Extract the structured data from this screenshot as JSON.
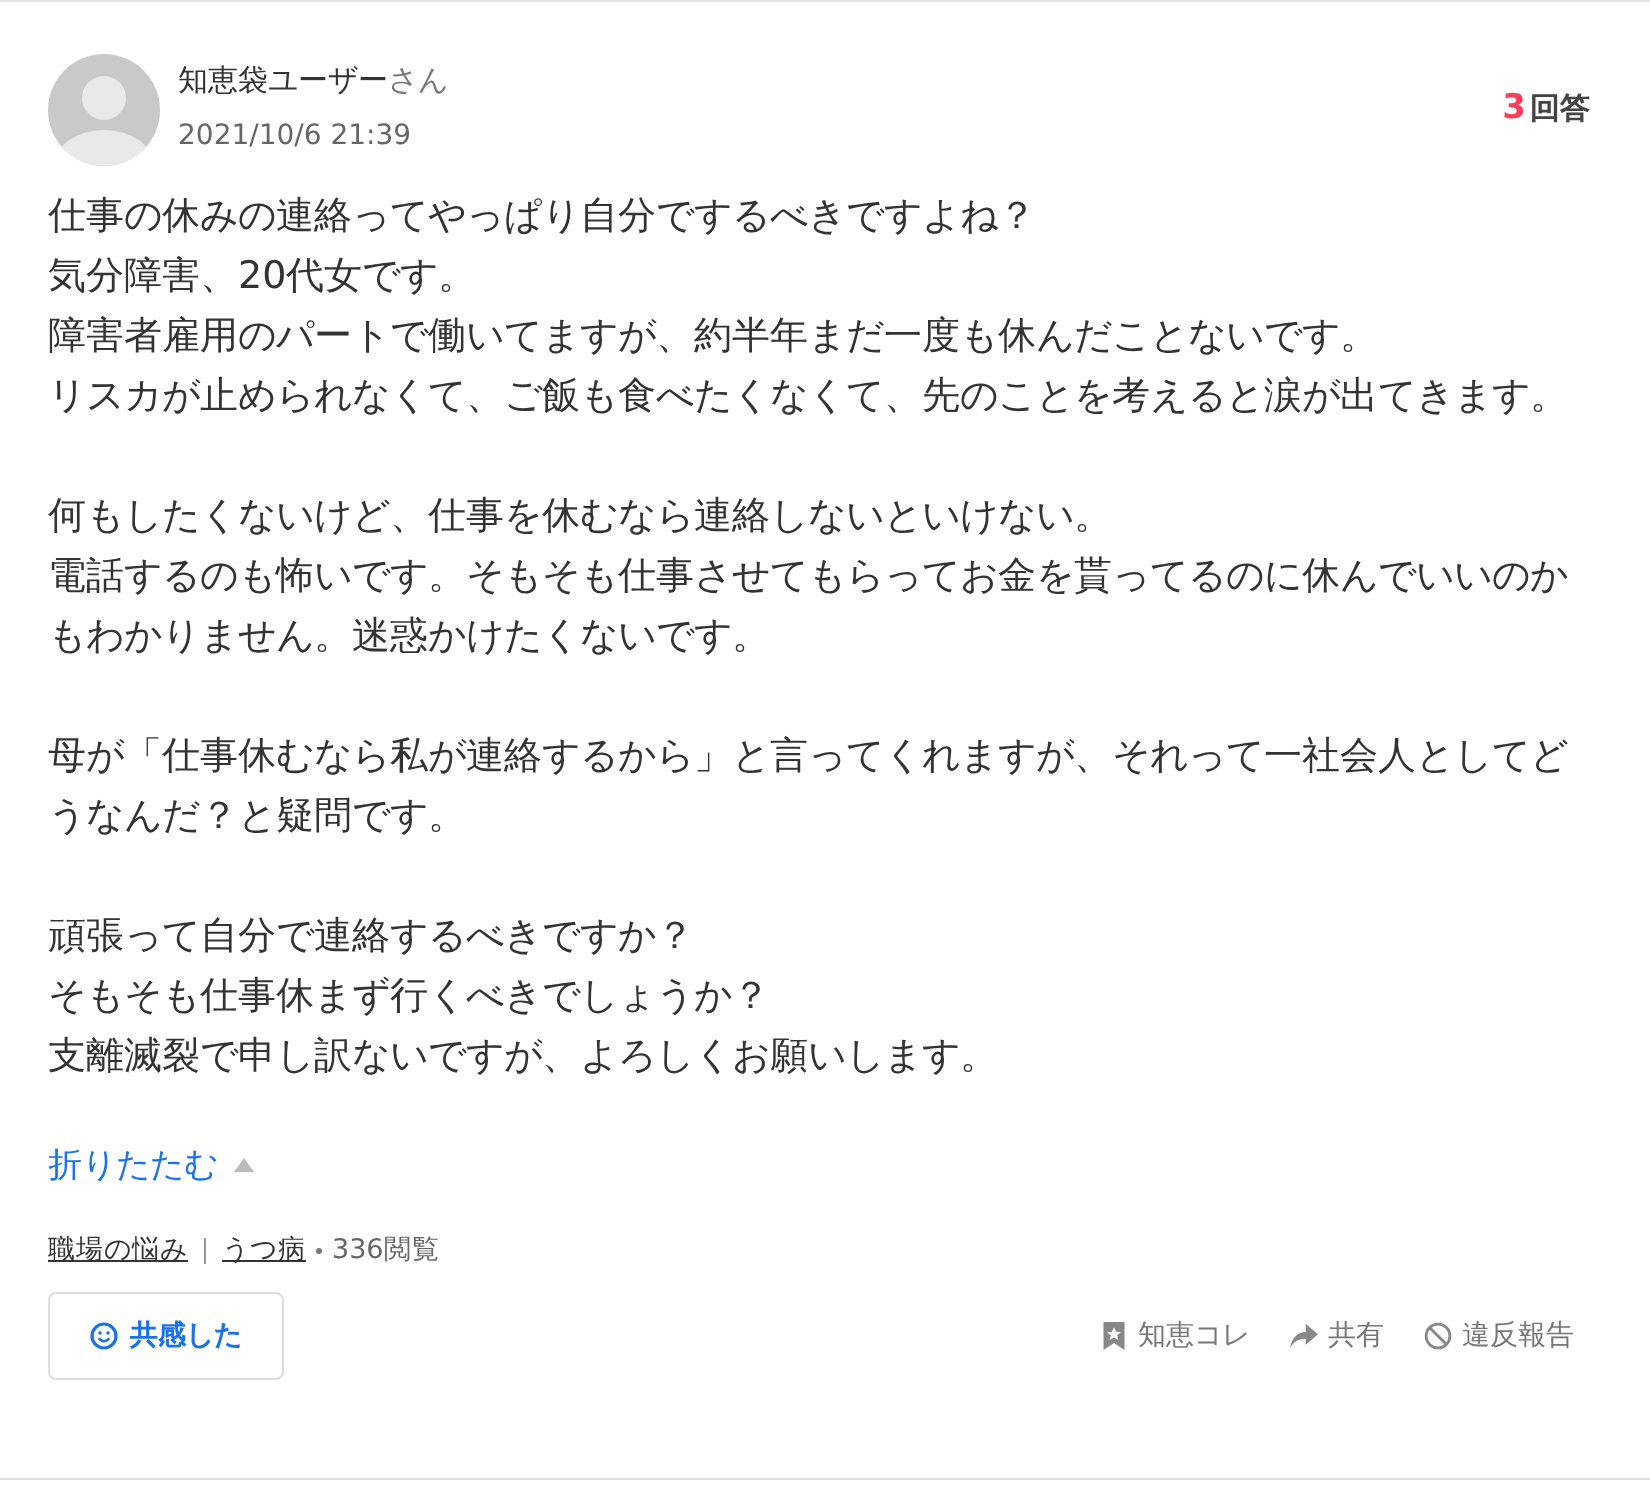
{
  "question": {
    "user_name": "知恵袋ユーザー",
    "honorific": "さん",
    "date": "2021/10/6 21:39",
    "answer_count": "3",
    "answer_label": "回答",
    "paragraphs": [
      [
        "仕事の休みの連絡ってやっぱり自分でするべきですよね？",
        "気分障害、20代女です。",
        "障害者雇用のパートで働いてますが、約半年まだ一度も休んだことないです。",
        "リスカが止められなくて、ご飯も食べたくなくて、先のことを考えると涙が出てきます。"
      ],
      [
        "何もしたくないけど、仕事を休むなら連絡しないといけない。",
        "電話するのも怖いです。そもそも仕事させてもらってお金を貰ってるのに休んでいいのかもわかりません。迷惑かけたくないです。"
      ],
      [
        "母が「仕事休むなら私が連絡するから」と言ってくれますが、それって一社会人としてどうなんだ？と疑問です。"
      ],
      [
        "頑張って自分で連絡するべきですか？",
        "そもそも仕事休まず行くべきでしょうか？",
        "支離滅裂で申し訳ないですが、よろしくお願いします。"
      ]
    ],
    "collapse_label": "折りたたむ",
    "categories": [
      "職場の悩み",
      "うつ病"
    ],
    "views": "336閲覧",
    "empathy_button": "共感した",
    "actions": [
      {
        "kind": "bookmark",
        "label": "知恵コレ"
      },
      {
        "kind": "share",
        "label": "共有"
      },
      {
        "kind": "report",
        "label": "違反報告"
      }
    ]
  }
}
